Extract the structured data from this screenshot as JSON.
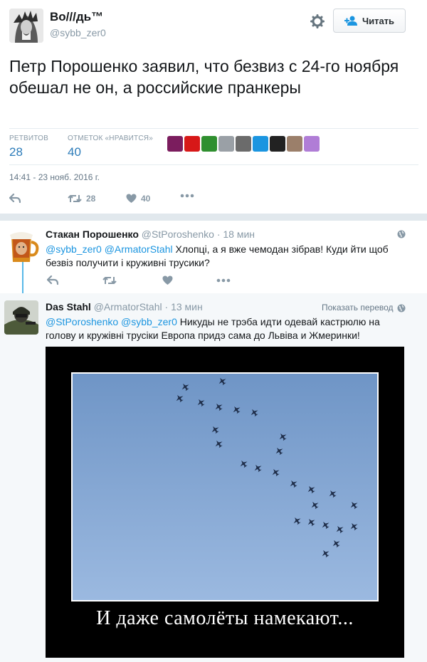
{
  "tweet": {
    "author_name": "Во///дь™",
    "author_handle": "@sybb_zer0",
    "follow_label": "Читать",
    "text": "Петр Порошенко заявил, что безвиз с 24-го ноября обешал не он, а российские пранкеры",
    "retweets_label": "РЕТВИТОВ",
    "retweets_count": "28",
    "likes_label": "ОТМЕТОК «НРАВИТСЯ»",
    "likes_count": "40",
    "timestamp": "14:41 - 23 нояб. 2016 г.",
    "action_retweet_count": "28",
    "action_like_count": "40",
    "liker_colors": [
      "#7b1d5e",
      "#d71818",
      "#2f8f2f",
      "#9aa0a6",
      "#6b6b6b",
      "#1b95e0",
      "#222222",
      "#9b7f6a",
      "#b07dd6"
    ]
  },
  "reply1": {
    "name": "Стакан Порошенко",
    "handle": "@StPoroshenko",
    "time": "· 18 мин",
    "mention1": "@sybb_zer0",
    "mention2": "@ArmatorStahl",
    "text": "Хлопці, а я вже чемодан зібрав! Куди йти щоб безвіз получити і круживні трусики?"
  },
  "reply2": {
    "name": "Das Stahl",
    "handle": "@ArmatorStahl",
    "time": "· 13 мин",
    "translate_label": "Показать перевод",
    "mention1": "@StPoroshenko",
    "mention2": "@sybb_zer0",
    "text": "Никуды не трэба идти одевай кастрюлю на голову и кружівні трусіки Европа придэ сама до Львіва и Жмеринки!",
    "image_caption": "И даже самолёты намекают..."
  },
  "colors": {
    "accent": "#1b95e0",
    "count_blue": "#2b7bb9",
    "muted": "#8899a6",
    "sky": "#7fa3d3"
  }
}
